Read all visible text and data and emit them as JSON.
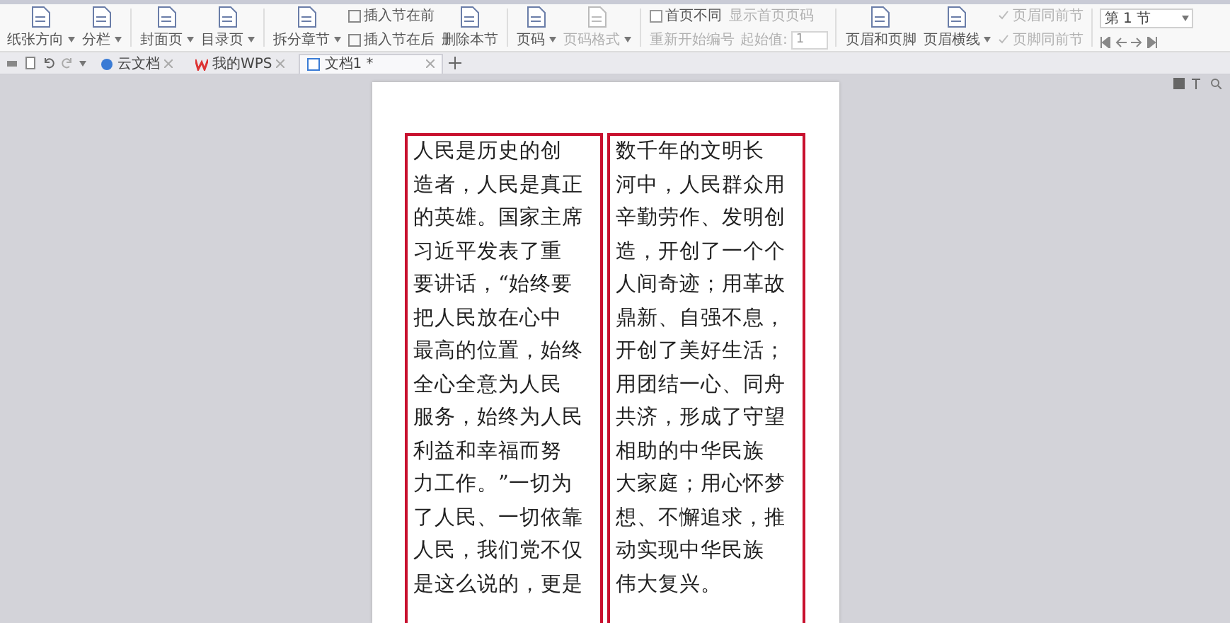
{
  "toolbar": [
    {
      "kind": "big",
      "label": "纸张方向",
      "dropdown": true,
      "disabled": false
    },
    {
      "kind": "big",
      "label": "分栏",
      "dropdown": true,
      "disabled": false
    },
    {
      "kind": "separator"
    },
    {
      "kind": "big",
      "label": "封面页",
      "dropdown": true,
      "disabled": false
    },
    {
      "kind": "big",
      "label": "目录页",
      "dropdown": true,
      "disabled": false
    },
    {
      "kind": "separator"
    },
    {
      "kind": "big",
      "label": "拆分章节",
      "dropdown": true,
      "disabled": false
    },
    {
      "kind": "stack",
      "items": [
        {
          "label": "插入节在前"
        },
        {
          "label": "插入节在后"
        }
      ]
    },
    {
      "kind": "big",
      "label": "删除本节",
      "dropdown": false,
      "disabled": false
    },
    {
      "kind": "separator"
    },
    {
      "kind": "big",
      "label": "页码",
      "dropdown": true,
      "disabled": false
    },
    {
      "kind": "big",
      "label": "页码格式",
      "dropdown": true,
      "disabled": true
    },
    {
      "kind": "separator"
    },
    {
      "kind": "numbering",
      "first_page": {
        "label": "首页不同",
        "checked": false
      },
      "show_first": {
        "label": "显示首页页码",
        "disabled": true
      },
      "restart": {
        "label": "重新开始编号",
        "disabled": true
      },
      "start_label": "起始值:",
      "start_value": "1"
    },
    {
      "kind": "separator"
    },
    {
      "kind": "big",
      "label": "页眉和页脚",
      "dropdown": false,
      "disabled": false
    },
    {
      "kind": "big",
      "label": "页眉横线",
      "dropdown": true,
      "disabled": false
    },
    {
      "kind": "checks",
      "items": [
        {
          "label": "页眉同前节",
          "checked": true
        },
        {
          "label": "页脚同前节",
          "checked": true
        }
      ]
    },
    {
      "kind": "separator"
    },
    {
      "kind": "section",
      "value": "第 1 节"
    }
  ],
  "tabs": [
    {
      "label": "云文档",
      "kind": "cloud",
      "selected": false
    },
    {
      "label": "我的WPS",
      "kind": "wps",
      "selected": false
    },
    {
      "label": "文档1 *",
      "kind": "doc",
      "selected": true
    }
  ],
  "columns": [
    {
      "lines": [
        "人民是历史的创",
        "造者，人民是真正",
        "的英雄。国家主席",
        "习近平发表了重",
        "要讲话，“始终要",
        "把人民放在心中",
        "最高的位置，始终",
        "全心全意为人民",
        "服务，始终为人民",
        "利益和幸福而努",
        "力工作。”一切为",
        "了人民、一切依靠",
        "人民，我们党不仅",
        "是这么说的，更是"
      ]
    },
    {
      "lines": [
        "数千年的文明长",
        "河中，人民群众用",
        "辛勤劳作、发明创",
        "造，开创了一个个",
        "人间奇迹；用革故",
        "鼎新、自强不息，",
        "开创了美好生活；",
        "用团结一心、同舟",
        "共济，形成了守望",
        "相助的中华民族",
        "大家庭；用心怀梦",
        "想、不懈追求，推",
        "动实现中华民族",
        "伟大复兴。"
      ]
    }
  ]
}
